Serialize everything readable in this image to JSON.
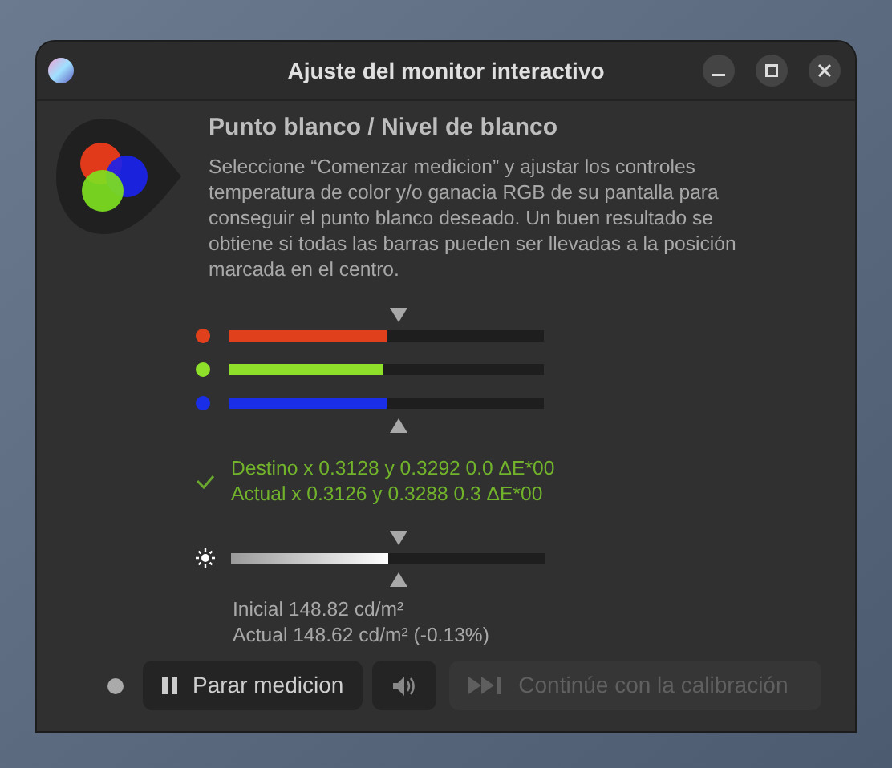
{
  "window": {
    "title": "Ajuste del monitor interactivo"
  },
  "heading": "Punto blanco / Nivel de blanco",
  "description": "Seleccione “Comenzar medicion” y ajustar los controles temperatura de color y/o ganacia RGB de su pantalla para conseguir el punto blanco deseado. Un buen resultado se obtiene si todas las barras pueden ser llevadas a la posición marcada en el centro.",
  "channels": [
    {
      "color": "#e0401c",
      "level": 0.5
    },
    {
      "color": "#8ee02a",
      "level": 0.49
    },
    {
      "color": "#1a2ee8",
      "level": 0.5
    }
  ],
  "result": {
    "ok": true,
    "target": "Destino x 0.3128 y 0.3292 0.0 ΔE*00",
    "actual": "Actual x 0.3126 y 0.3288 0.3 ΔE*00"
  },
  "brightness": {
    "level": 0.5,
    "initial": "Inicial 148.82 cd/m²",
    "actual": "Actual 148.62 cd/m² (-0.13%)"
  },
  "buttons": [
    {
      "kind": "pause",
      "label": "Parar medicion",
      "disabled": false
    },
    {
      "kind": "sound",
      "disabled": false
    },
    {
      "kind": "next",
      "label": "Continúe con la calibración",
      "disabled": true
    }
  ]
}
